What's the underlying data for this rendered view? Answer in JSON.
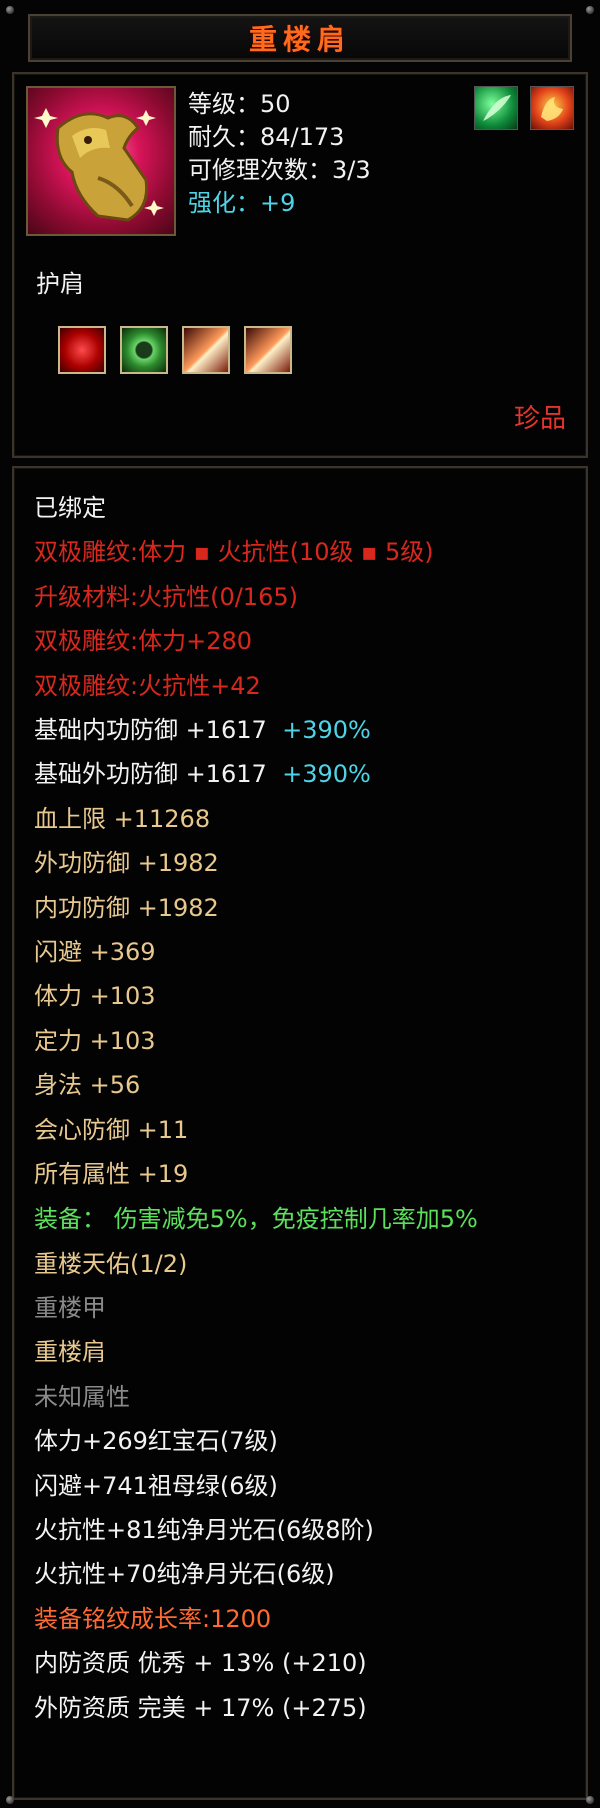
{
  "title": "重楼肩",
  "icons": {
    "item": "dragon-shoulder-armor-icon",
    "badge1": "green-feather-icon",
    "badge2": "fire-emblem-icon"
  },
  "stats": {
    "level": "等级：50",
    "durability": "耐久：84/173",
    "repairs": "可修理次数：3/3",
    "enhance": "强化：+9"
  },
  "item_type": "护肩",
  "gems": [
    "red-gem-icon",
    "jade-ring-icon",
    "wing-rune-icon",
    "wing-rune-icon"
  ],
  "rarity": "珍品",
  "bound": "已绑定",
  "engrave": {
    "dual": "双极雕纹:体力 ▪ 火抗性(10级 ▪ 5级)",
    "upgrade": "升级材料:火抗性(0/165)",
    "dual_hp": "双极雕纹:体力+280",
    "dual_fire": "双极雕纹:火抗性+42"
  },
  "base": [
    {
      "label": "基础内功防御  +1617",
      "pct": "+390%"
    },
    {
      "label": "基础外功防御  +1617",
      "pct": "+390%"
    }
  ],
  "attrs": [
    "血上限  +11268",
    "外功防御  +1982",
    "内功防御  +1982",
    "闪避  +369",
    "体力  +103",
    "定力  +103",
    "身法  +56",
    "会心防御  +11",
    "所有属性  +19"
  ],
  "equip_effect": "装备： 伤害减免5%，免疫控制几率加5%",
  "set": {
    "name": "重楼天佑(1/2)",
    "piece1": "重楼甲",
    "piece2": "重楼肩",
    "unknown": "未知属性"
  },
  "sockets": [
    "体力+269红宝石(7级)",
    "闪避+741祖母绿(6级)",
    "火抗性+81纯净月光石(6级8阶)",
    "火抗性+70纯净月光石(6级)"
  ],
  "growth": "装备铭纹成长率:1200",
  "quality": [
    "内防资质  优秀  + 13% (+210)",
    "外防资质  完美  + 17% (+275)"
  ]
}
